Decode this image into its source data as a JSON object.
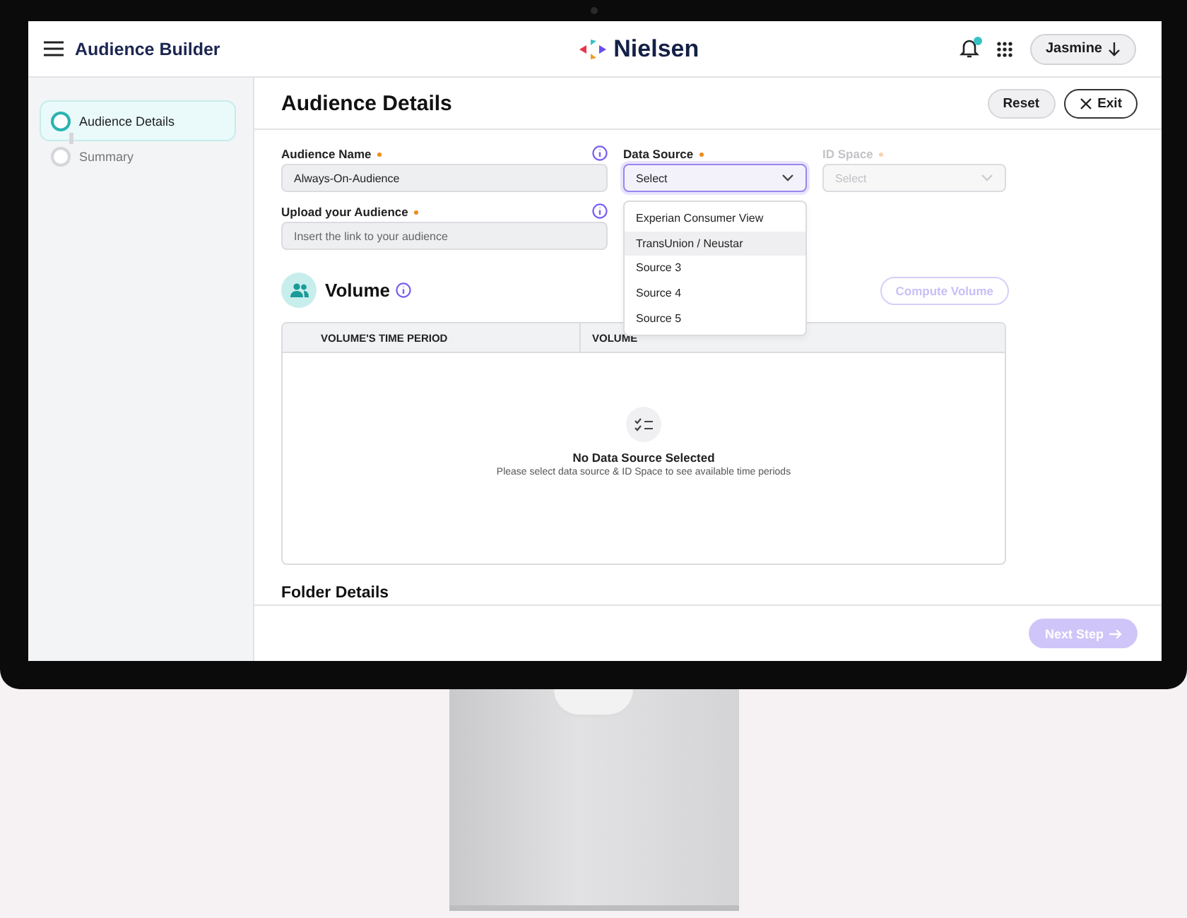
{
  "header": {
    "title": "Audience Builder",
    "logo": "Nielsen",
    "notification_unread": true,
    "user": "Jasmine"
  },
  "steps": [
    {
      "label": "Audience Details",
      "selected": true
    },
    {
      "label": "Summary",
      "selected": false
    }
  ],
  "page": {
    "title": "Audience Details",
    "buttons": [
      {
        "kind": "reset",
        "label": "Reset"
      },
      {
        "kind": "exit",
        "label": "Exit"
      }
    ]
  },
  "audience_name": {
    "label": "Audience Name",
    "required": true,
    "value": "Always-On-Audience"
  },
  "upload": {
    "label": "Upload your Audience",
    "required": true,
    "placeholder": "Insert the link to your audience"
  },
  "data_source": {
    "label": "Data Source",
    "required": true,
    "value": "Select",
    "open": true,
    "options": [
      {
        "label": "Experian Consumer View",
        "selected": false
      },
      {
        "label": "TransUnion / Neustar",
        "selected": true
      },
      {
        "label": "Source 3",
        "selected": false
      },
      {
        "label": "Source 4",
        "selected": false
      },
      {
        "label": "Source 5",
        "selected": false
      }
    ]
  },
  "id_space": {
    "label": "ID Space",
    "required": true,
    "placeholder": "Select",
    "disabled": true
  },
  "volume": {
    "title": "Volume",
    "compute_button": {
      "label": "Compute Volume",
      "disabled": true
    },
    "columns": [
      "VOLUME'S TIME PERIOD",
      "VOLUME"
    ],
    "empty_title": "No Data Source Selected",
    "empty_message": "Please select data source & ID Space to see available time periods"
  },
  "folder_details": {
    "title": "Folder Details"
  },
  "footer": {
    "next_button": {
      "label": "Next Step",
      "disabled": true
    }
  }
}
